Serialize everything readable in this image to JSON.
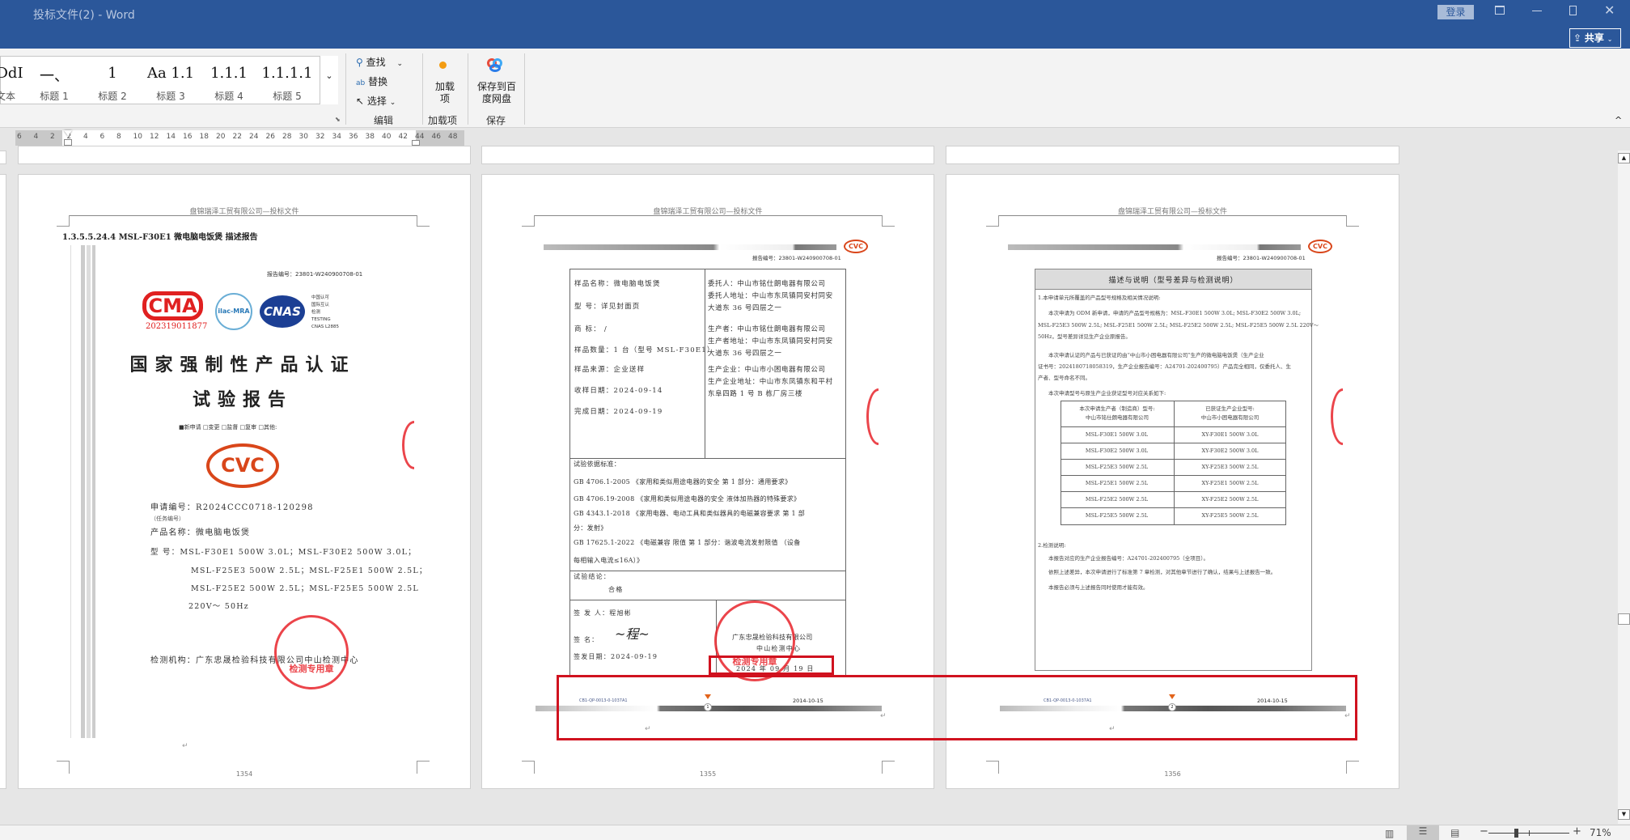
{
  "window": {
    "title": "投标文件(2)  -  Word",
    "login": "登录",
    "share": "共享"
  },
  "ribbon": {
    "styles": [
      {
        "preview": "cDdI",
        "label": "文本"
      },
      {
        "preview": "一、",
        "label": "标题 1"
      },
      {
        "preview": "1",
        "label": "标题 2"
      },
      {
        "preview": "Aa 1.1",
        "label": "标题 3"
      },
      {
        "preview": "1.1.1",
        "label": "标题 4"
      },
      {
        "preview": "1.1.1.1",
        "label": "标题 5"
      }
    ],
    "edit": {
      "find": "查找",
      "replace": "替换",
      "select": "选择",
      "group": "编辑"
    },
    "addins": {
      "button": "加载项",
      "group": "加载项"
    },
    "save": {
      "button": "保存到百度网盘",
      "group": "保存"
    }
  },
  "ruler": {
    "ticks": [
      "6",
      "4",
      "2",
      "2",
      "4",
      "6",
      "8",
      "10",
      "12",
      "14",
      "16",
      "18",
      "20",
      "22",
      "24",
      "26",
      "28",
      "30",
      "32",
      "34",
      "36",
      "38",
      "40",
      "42",
      "44",
      "46",
      "48"
    ]
  },
  "doc_header": "盘锦瑞泽工贸有限公司—投标文件",
  "page1": {
    "heading": "1.3.5.5.24.4  MSL-F30E1 微电脑电饭煲 描述报告",
    "report_no": "报告编号：23801-W240900708-01",
    "cma_no": "202319011877",
    "cnas_text": [
      "中国认可",
      "国际互认",
      "检测",
      "TESTING",
      "CNAS L2885"
    ],
    "title1": "国家强制性产品认证",
    "title2": "试验报告",
    "checkboxes": "■新申请 □变更 □监督 □复审 □其他:",
    "cvc": "CVC",
    "apply_no": "申请编号：R2024CCC0718-120298",
    "task_no": "（任务编号）",
    "product": "产品名称：微电脑电饭煲",
    "model_lines": [
      "型      号：MSL-F30E1 500W 3.0L；MSL-F30E2 500W 3.0L；",
      "MSL-F25E3 500W 2.5L；MSL-F25E1 500W 2.5L；",
      "MSL-F25E2 500W 2.5L；MSL-F25E5 500W 2.5L",
      "220V～ 50Hz"
    ],
    "lab": "检测机构：广东忠晟检验科技有限公司中山检测中心",
    "stamp": "检测专用章",
    "page_no": "1354"
  },
  "page2": {
    "report_no": "报告编号：23801-W240900708-01",
    "left": [
      "样品名称：微电脑电饭煲",
      "型      号：详见封面页",
      "商      标： /",
      "样品数量：1 台（型号 MSL-F30E1）",
      "样品来源：企业送样",
      "收样日期：2024-09-14",
      "完成日期：2024-09-19"
    ],
    "right": [
      "委托人：中山市铭仕朗电器有限公司",
      "委托人地址：中山市东凤镇同安村同安",
      "大道东 36 号四层之一",
      "生产者：中山市铭仕朗电器有限公司",
      "生产者地址：中山市东凤镇同安村同安",
      "大道东 36 号四层之一",
      "生产企业：中山市小困电器有限公司",
      "生产企业地址：中山市东凤镇东和平村",
      "东阜四路 1 号 B 栋厂房三楼"
    ],
    "standards": [
      "试验依据标准：",
      "GB 4706.1-2005 《家用和类似用途电器的安全 第 1 部分：通用要求》",
      "GB 4706.19-2008 《家用和类似用途电器的安全 液体加热器的特殊要求》",
      "GB 4343.1-2018 《家用电器、电动工具和类似器具的电磁兼容要求 第 1 部",
      "分：发射》",
      "GB 17625.1-2022 《电磁兼容 限值 第 1 部分：谐波电流发射限值 （设备",
      "每相输入电流≤16A）》"
    ],
    "conclusion_label": "试验结论：",
    "conclusion": "合格",
    "issuer": "签 发 人：程旭彬",
    "sign": "签      名：",
    "issue_date": "签发日期：2024-09-19",
    "company": "广东忠晟检验科技有限公司",
    "center": "中山检测中心",
    "stamp": "检测专用章",
    "stamp_date": "2024 年 09 月 19 日",
    "footer_code": "CB1-QP-0013-0-1037A1",
    "footer_date": "2014-10-15",
    "footer_page": "1",
    "page_no": "1355"
  },
  "page3": {
    "report_no": "报告编号：23801-W240900708-01",
    "box_title": "描述与说明（型号差异与检测说明）",
    "para": [
      "1.本申请单元所覆盖的产品型号规格及相关情况说明:",
      "本次申请为 ODM 新申请，申请的产品型号规格为：MSL-F30E1 500W 3.0L; MSL-F30E2 500W 3.0L;",
      "MSL-F25E3 500W 2.5L; MSL-F25E1 500W 2.5L; MSL-F25E2 500W 2.5L; MSL-F25E5 500W 2.5L 220V～",
      "50Hz，型号差异详见生产企业原报告。",
      "本次申请认证的产品与已获证的由“中山市小困电器有限公司”生产的微电脑电饭煲（生产企业",
      "证书号：2024180718058319，生产企业报告编号：A24701-202400795）产品完全相同，仅委托人、生",
      "产者、型号命名不同。",
      "本次申请型号与原生产企业获证型号对应关系如下:"
    ],
    "table_head": [
      [
        "本次申请生产者（制造商）型号:",
        "中山市铭仕朗电器有限公司"
      ],
      [
        "已获证生产企业型号:",
        "中山市小困电器有限公司"
      ]
    ],
    "table_rows": [
      [
        "MSL-F30E1 500W 3.0L",
        "XY-F30E1 500W 3.0L"
      ],
      [
        "MSL-F30E2 500W 3.0L",
        "XY-F30E2 500W 3.0L"
      ],
      [
        "MSL-F25E3 500W 2.5L",
        "XY-F25E3 500W 2.5L"
      ],
      [
        "MSL-F25E1 500W 2.5L",
        "XY-F25E1 500W 2.5L"
      ],
      [
        "MSL-F25E2 500W 2.5L",
        "XY-F25E2 500W 2.5L"
      ],
      [
        "MSL-F25E5 500W 2.5L",
        "XY-F25E5 500W 2.5L"
      ]
    ],
    "notes": [
      "2.检测说明:",
      "本报告对应的生产企业报告编号：A24701-202400795（全项目）。",
      "依照上述差异，本次申请进行了标准第 7 章检测，对其他章节进行了确认，结果与上述报告一致。",
      "本报告必须与上述报告同时使用才能有效。"
    ],
    "footer_code": "CB1-QP-0013-0-1037A1",
    "footer_date": "2014-10-15",
    "footer_page": "2",
    "page_no": "1356"
  },
  "statusbar": {
    "zoom": "71%",
    "zoom_level": 71
  },
  "colors": {
    "titlebar": "#2b579a",
    "highlight": "#d0121f",
    "stamp": "#e8242b"
  }
}
